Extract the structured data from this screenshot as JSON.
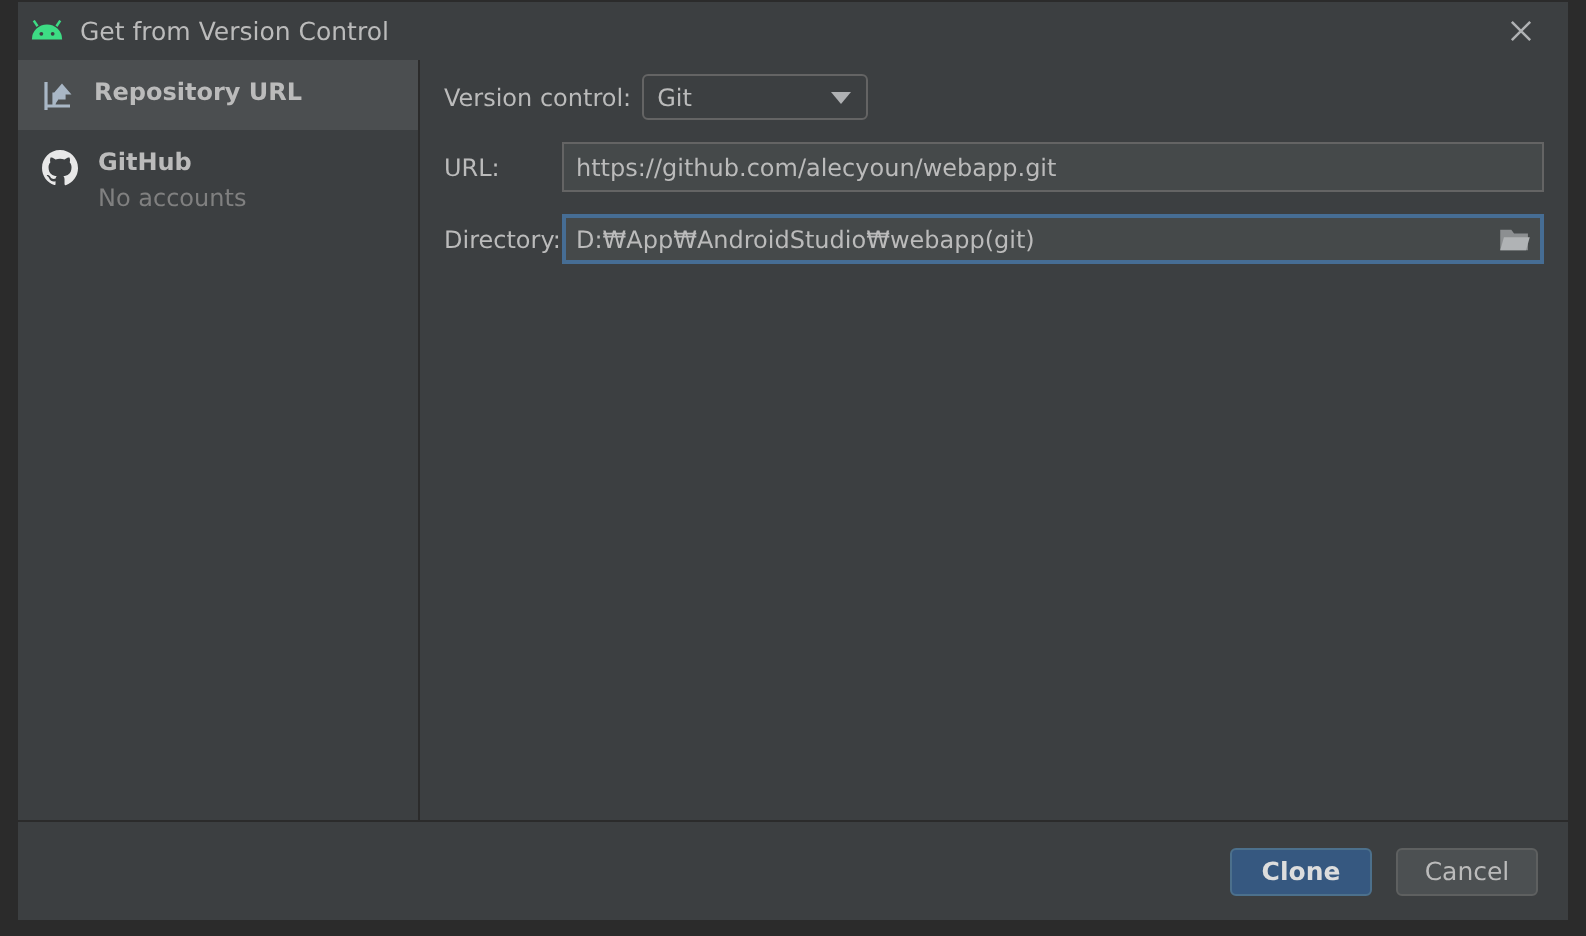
{
  "window": {
    "title": "Get from Version Control"
  },
  "sidebar": {
    "items": [
      {
        "kind": "repository",
        "label": "Repository URL",
        "selected": true
      },
      {
        "kind": "github",
        "label": "GitHub",
        "subtitle": "No accounts",
        "selected": false
      }
    ]
  },
  "form": {
    "version_control": {
      "label": "Version control:",
      "value": "Git"
    },
    "url": {
      "label": "URL:",
      "value": "https://github.com/alecyoun/webapp.git",
      "focused": false
    },
    "directory": {
      "label": "Directory:",
      "value": "D:₩App₩AndroidStudio₩webapp(git)",
      "focused": true
    }
  },
  "buttons": [
    {
      "label": "Clone",
      "primary": true
    },
    {
      "label": "Cancel",
      "primary": false
    }
  ]
}
